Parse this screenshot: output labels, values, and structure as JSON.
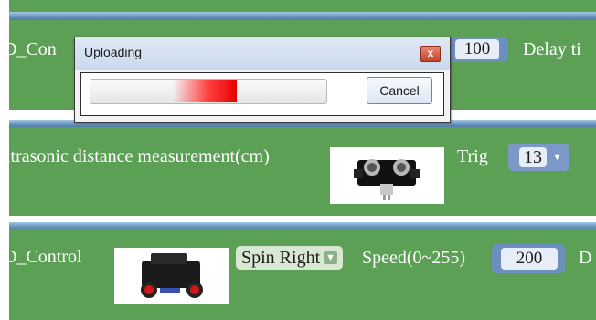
{
  "block1": {
    "label": "D_Con",
    "value": "100",
    "delay_label": "Delay ti"
  },
  "block2": {
    "label": "ltrasonic distance measurement(cm)",
    "trig_label": "Trig",
    "trig_value": "13"
  },
  "block3": {
    "label": "D_Control",
    "mode": "Spin Right",
    "speed_label": "Speed(0~255)",
    "speed_value": "200",
    "trailing": "D"
  },
  "dialog": {
    "title": "Uploading",
    "close_glyph": "x",
    "progress": 0.62,
    "cancel_label": "Cancel"
  },
  "colors": {
    "block": "#5ca056",
    "block_band": "#6f98c2",
    "progress_fill": "#e60000"
  },
  "icons": {
    "dropdown": "caret-down-icon",
    "close": "close-icon"
  }
}
